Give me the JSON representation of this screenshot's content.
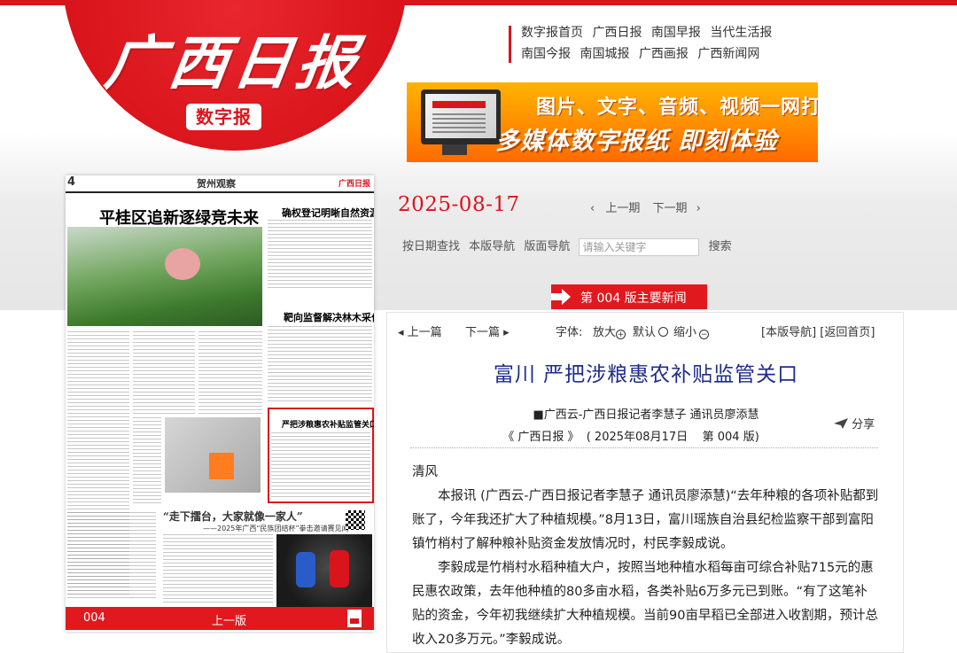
{
  "header": {
    "logo_text": "广西日报",
    "logo_sub": "数字报",
    "nav_row1": [
      "数字报首页",
      "广西日报",
      "南国早报",
      "当代生活报"
    ],
    "nav_row2": [
      "南国今报",
      "南国城报",
      "广西画报",
      "广西新闻网"
    ]
  },
  "banner": {
    "line1": "图片、文字、音频、视频一网打尽!",
    "line2": "多媒体数字报纸  即刻体验"
  },
  "paper": {
    "page_num": "4",
    "section": "贺州观察",
    "logo": "广西日报",
    "main_title": "平桂区追新逐绿竞未来",
    "right_title1": "确权登记明晰自然资源产权",
    "right_title2": "靶向监督解决林木采伐办证难",
    "highlight_title": "严把涉粮惠农补贴监管关口",
    "lower_title": "“走下擂台，大家就像一家人”",
    "lower_sub": "——2025年广西“民族团结杯”拳击邀请赛见闻",
    "footer_page": "004",
    "footer_prev": "上一版"
  },
  "issue": {
    "date": "2025-08-17",
    "prev": "上一期",
    "next": "下一期",
    "search_links": [
      "按日期查找",
      "本版导航",
      "版面导航"
    ],
    "search_placeholder": "请输入关键字",
    "search_button": "搜索",
    "version_label": "第 004 版主要新闻"
  },
  "article": {
    "prev": "上一篇",
    "next": "下一篇",
    "font_label": "字体:",
    "font_big": "放大",
    "font_default": "默认",
    "font_small": "缩小",
    "links": "[本版导航] [返回首页]",
    "headline": "富川  严把涉粮惠农补贴监管关口",
    "byline": "■广西云-广西日报记者李慧子 通讯员廖添慧",
    "share": "分享",
    "source": "《 广西日报 》  ( 2025年08月17日    第 004 版)",
    "paragraphs": [
      "清风",
      "本报讯  (广西云-广西日报记者李慧子 通讯员廖添慧)“去年种粮的各项补贴都到账了，今年我还扩大了种植规模。”8月13日，富川瑶族自治县纪检监察干部到富阳镇竹梢村了解种粮补贴资金发放情况时，村民李毅成说。",
      "李毅成是竹梢村水稻种植大户，按照当地种植水稻每亩可综合补贴715元的惠民惠农政策，去年他种植的80多亩水稻，各类补贴6万多元已到账。“有了这笔补贴的资金，今年初我继续扩大种植规模。当前90亩早稻已全部进入收割期，预计总收入20多万元。”李毅成说。"
    ]
  },
  "colors": {
    "brand_red": "#d9141b",
    "headline_blue": "#1f2c8a",
    "banner_orange": "#ff8c00"
  }
}
